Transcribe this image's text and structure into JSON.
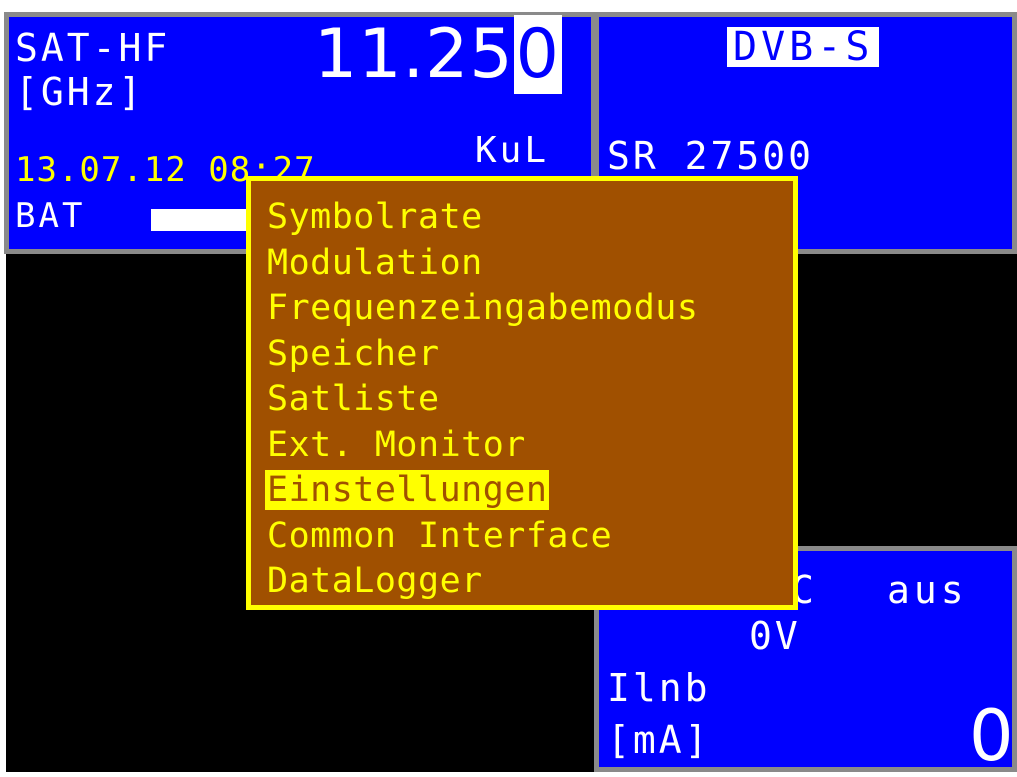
{
  "top_left": {
    "title": "SAT-HF",
    "unit": "[GHz]",
    "frequency_main": "11.25",
    "frequency_cursor_digit": "0",
    "band": "KuL",
    "datetime": "13.07.12 08:27",
    "battery_label": "BAT"
  },
  "top_right": {
    "standard": "DVB-S",
    "symbol_rate": "SR 27500"
  },
  "bottom_right": {
    "partial_char": "C",
    "state": "aus",
    "voltage": "0V",
    "current_label": "Ilnb",
    "current_unit": "[mA]",
    "current_value": "0"
  },
  "menu": {
    "selected_index": 6,
    "items": [
      {
        "label": "Symbolrate"
      },
      {
        "label": "Modulation"
      },
      {
        "label": "Frequenzeingabemodus"
      },
      {
        "label": "Speicher"
      },
      {
        "label": "Satliste"
      },
      {
        "label": "Ext. Monitor"
      },
      {
        "label": "Einstellungen"
      },
      {
        "label": "Common Interface"
      },
      {
        "label": "DataLogger"
      }
    ]
  },
  "colors": {
    "panel_bg": "#0000ff",
    "panel_border": "#8a8a8a",
    "menu_bg": "#a05000",
    "menu_fg": "#ffff00",
    "screen_bg": "#000000"
  }
}
